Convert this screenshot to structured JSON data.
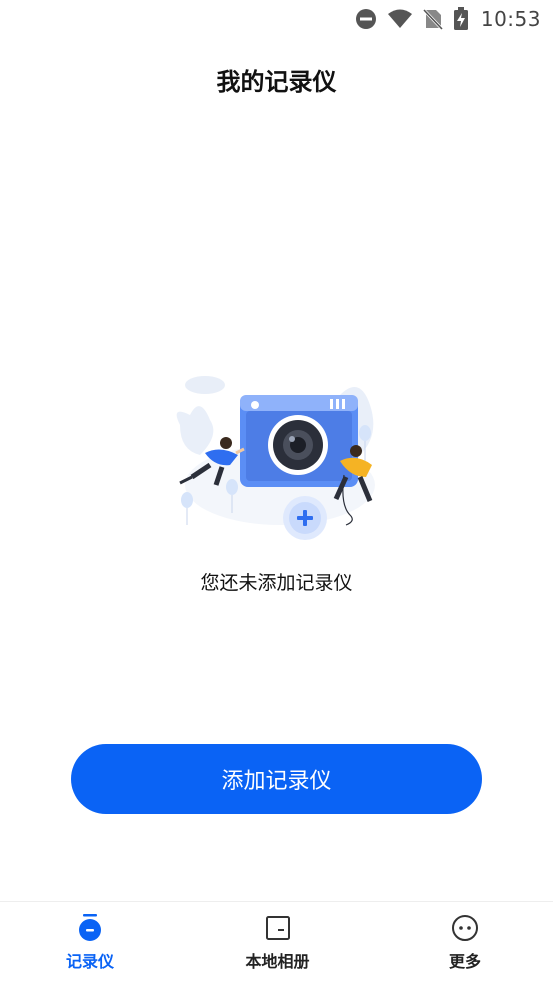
{
  "status_bar": {
    "time": "10:53",
    "icons": [
      "do-not-disturb-icon",
      "wifi-icon",
      "no-sim-icon",
      "battery-charging-icon"
    ]
  },
  "header": {
    "title": "我的记录仪"
  },
  "empty_state": {
    "illustration": "camera-add-illustration",
    "message": "您还未添加记录仪"
  },
  "actions": {
    "add_button_label": "添加记录仪"
  },
  "bottom_nav": {
    "items": [
      {
        "label": "记录仪",
        "icon": "recorder-icon",
        "active": true
      },
      {
        "label": "本地相册",
        "icon": "album-icon",
        "active": false
      },
      {
        "label": "更多",
        "icon": "more-icon",
        "active": false
      }
    ]
  },
  "colors": {
    "accent": "#0a63f5",
    "text": "#111111",
    "status_icon": "#555555"
  }
}
